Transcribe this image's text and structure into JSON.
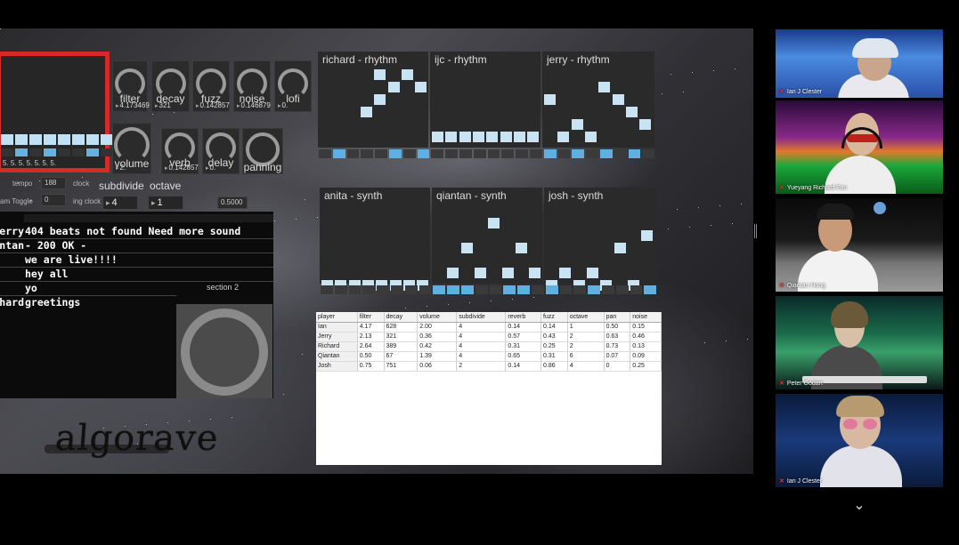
{
  "controls": {
    "filter": {
      "label": "filter",
      "value": "4.173469"
    },
    "decay": {
      "label": "decay",
      "value": "321"
    },
    "fuzz": {
      "label": "fuzz",
      "value": "0.142857"
    },
    "noise": {
      "label": "noise",
      "value": "0.146879"
    },
    "lofi": {
      "label": "lofi",
      "value": "0."
    },
    "volume": {
      "label": "volume",
      "value": "2."
    },
    "verb": {
      "label": "verb",
      "value": "0.142857"
    },
    "delay": {
      "label": "delay",
      "value": "0."
    },
    "panning": {
      "label": "panning"
    }
  },
  "sequencer": {
    "step_values": "5. 5. 5. 5. 5. 5. 5."
  },
  "transport": {
    "tempo_label": "tempo",
    "tempo_value": "188",
    "clock_label": "clock",
    "toggle_label": "am Toggle",
    "toggle_value": "0",
    "ing_clock_label": "ing clock",
    "subdivide_label": "subdivide",
    "subdivide_value": "4",
    "octave_label": "octave",
    "octave_value": "1",
    "extra_value": "0.5000"
  },
  "chat": {
    "messages": [
      {
        "who": "erry",
        "text": "404 beats not found Need more sound"
      },
      {
        "who": "Qiantan",
        "text": "- 200 OK -"
      },
      {
        "who": "",
        "text": "we are live!!!!"
      },
      {
        "who": "",
        "text": "hey all"
      },
      {
        "who": "",
        "text": "yo"
      },
      {
        "who": "Richard",
        "text": "greetings"
      }
    ],
    "section_label": "section 2"
  },
  "grids": [
    {
      "title": "richard - rhythm"
    },
    {
      "title": "ijc - rhythm"
    },
    {
      "title": "jerry - rhythm"
    },
    {
      "title": "anita - synth"
    },
    {
      "title": "qiantan - synth"
    },
    {
      "title": "josh - synth"
    }
  ],
  "table": {
    "columns": [
      "player",
      "filter",
      "decay",
      "volume",
      "subdivide",
      "reverb",
      "fuzz",
      "octave",
      "pan",
      "noise"
    ],
    "rows": [
      [
        "Ian",
        "4.17",
        "628",
        "2.00",
        "4",
        "0.14",
        "0.14",
        "1",
        "0.50",
        "0.15"
      ],
      [
        "Jerry",
        "2.13",
        "321",
        "0.36",
        "4",
        "0.57",
        "0.43",
        "2",
        "0.63",
        "0.46"
      ],
      [
        "Richard",
        "2.64",
        "389",
        "0.42",
        "4",
        "0.31",
        "0.25",
        "2",
        "0.73",
        "0.13"
      ],
      [
        "Qiantan",
        "0.50",
        "67",
        "1.39",
        "4",
        "0.65",
        "0.31",
        "6",
        "0.07",
        "0.09"
      ],
      [
        "Josh",
        "0.75",
        "751",
        "0.06",
        "2",
        "0.14",
        "0.86",
        "4",
        "0",
        "0.25"
      ]
    ]
  },
  "logo": {
    "text": "algorave"
  },
  "participants": [
    {
      "name": "Ian J Clester"
    },
    {
      "name": "Yueyang Richard Fan"
    },
    {
      "name": "Qiantan Hong"
    },
    {
      "name": "Peter Godart"
    },
    {
      "name": "Ian J Clester"
    }
  ],
  "colors": {
    "accent_red": "#d42a2a",
    "cell": "#c9e3f2",
    "step_on": "#5fb0e0"
  }
}
